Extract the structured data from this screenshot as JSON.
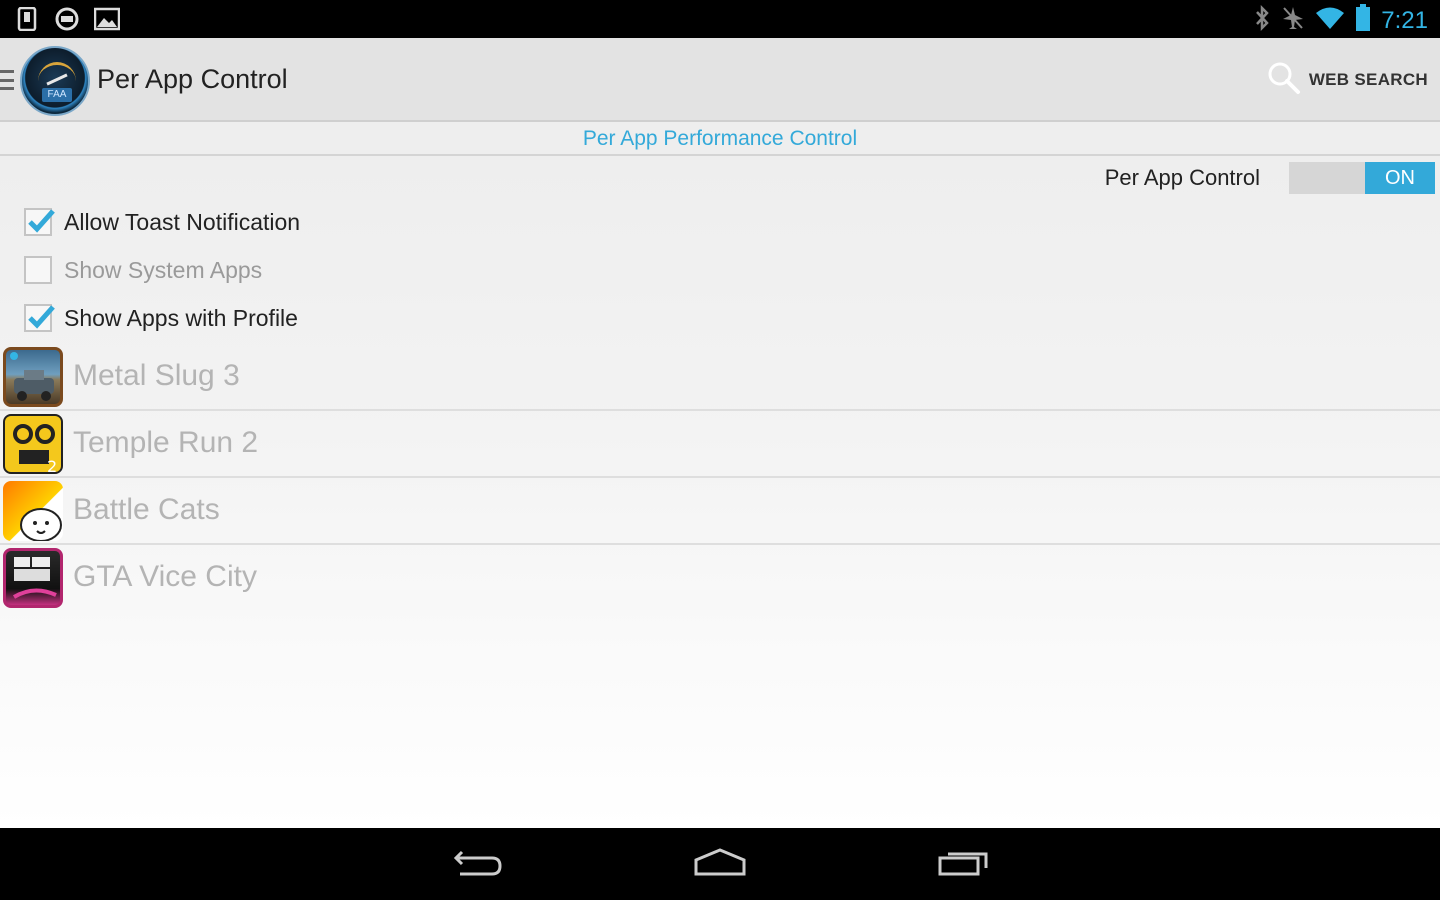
{
  "status_bar": {
    "left_icons": [
      "sim-card-icon",
      "gamepad-icon",
      "picture-icon"
    ],
    "right_icons": [
      "bluetooth-icon",
      "airplane-off-icon",
      "wifi-icon",
      "battery-icon"
    ],
    "time": "7:21",
    "accent_color": "#33b5e5"
  },
  "action_bar": {
    "title": "Per App Control",
    "search_label": "WEB SEARCH",
    "logo_text": "FAA"
  },
  "subheader": {
    "title": "Per App Performance Control",
    "color": "#33a9d9"
  },
  "toggle": {
    "label": "Per App Control",
    "state": "ON",
    "color": "#33a9d9"
  },
  "checkboxes": [
    {
      "label": "Allow Toast Notification",
      "checked": true,
      "enabled": true
    },
    {
      "label": "Show System Apps",
      "checked": false,
      "enabled": false
    },
    {
      "label": "Show Apps with Profile",
      "checked": true,
      "enabled": true
    }
  ],
  "apps": [
    {
      "name": "Metal Slug 3",
      "icon": "metal-slug-icon"
    },
    {
      "name": "Temple Run 2",
      "icon": "temple-run-icon"
    },
    {
      "name": "Battle Cats",
      "icon": "battle-cats-icon"
    },
    {
      "name": "GTA Vice City",
      "icon": "gta-vice-city-icon"
    }
  ],
  "nav_bar": {
    "buttons": [
      "back-icon",
      "home-icon",
      "recents-icon"
    ]
  }
}
